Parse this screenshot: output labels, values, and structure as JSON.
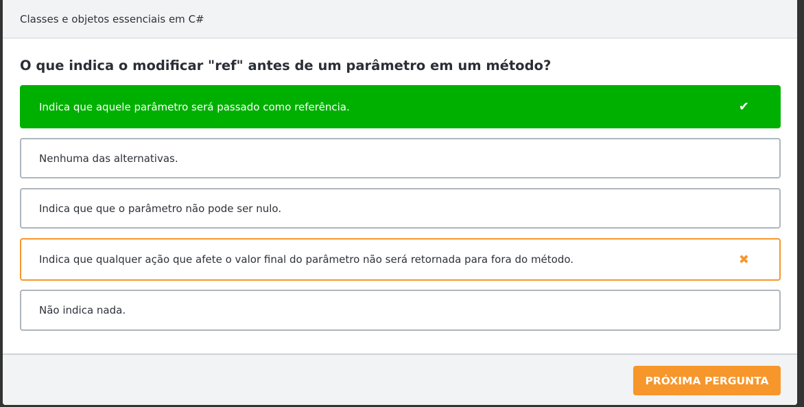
{
  "header": {
    "title": "Classes e objetos essenciais em C#"
  },
  "question": "O que indica o modificar \"ref\" antes de um parâmetro em um método?",
  "options": [
    {
      "label": "Indica que aquele parâmetro será passado como referência.",
      "state": "correct",
      "icon": "check-icon",
      "glyph": "✔"
    },
    {
      "label": "Nenhuma das alternativas.",
      "state": "neutral"
    },
    {
      "label": "Indica que que o parâmetro não pode ser nulo.",
      "state": "neutral"
    },
    {
      "label": "Indica que qualquer ação que afete o valor final do parâmetro não será retornada para fora do método.",
      "state": "wrong",
      "icon": "x-icon",
      "glyph": "✖"
    },
    {
      "label": "Não indica nada.",
      "state": "neutral"
    }
  ],
  "footer": {
    "next_label": "PRÓXIMA PERGUNTA"
  },
  "colors": {
    "correct": "#00b000",
    "wrong": "#f7962b",
    "accent": "#f7962b"
  }
}
